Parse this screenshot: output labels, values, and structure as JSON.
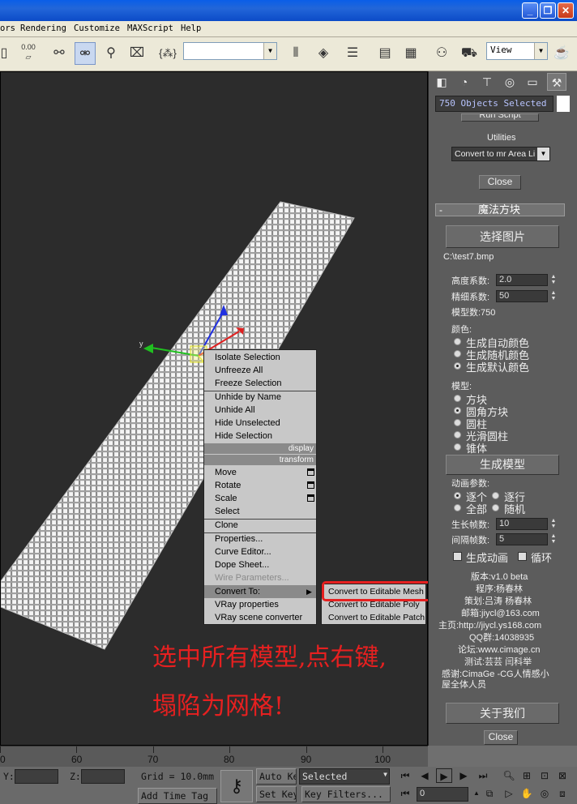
{
  "titlebar": {
    "minimize": "_",
    "restore": "❐",
    "close": "✕"
  },
  "menubar": {
    "items": [
      "ors",
      "Rendering",
      "Customize",
      "MAXScript",
      "Help"
    ]
  },
  "toolbar": {
    "spinner_value": "0.00",
    "named_selection": "",
    "view_dropdown": "View",
    "braces": "{⁂}"
  },
  "command_panel": {
    "objects_selected": "750 Objects Selected",
    "run_script": "Run Script",
    "utilities_label": "Utilities",
    "utility_dropdown": "Convert to mr Area Li",
    "close_top": "Close",
    "rollout_toggle": "-",
    "rollout_title": "魔法方块",
    "select_image": "选择图片",
    "image_path": "C:\\test7.bmp",
    "height_label": "高度系数:",
    "height_value": "2.0",
    "detail_label": "精细系数:",
    "detail_value": "50",
    "model_count": "模型数:750",
    "color_label": "颜色:",
    "color_options": [
      "生成自动颜色",
      "生成随机颜色",
      "生成默认颜色"
    ],
    "model_label": "模型:",
    "model_options": [
      "方块",
      "圆角方块",
      "圆柱",
      "光滑圆柱",
      "锥体"
    ],
    "generate_model": "生成模型",
    "anim_label": "动画参数:",
    "anim_options": [
      "逐个",
      "逐行",
      "全部",
      "随机"
    ],
    "grow_label": "生长帧数:",
    "grow_value": "10",
    "interval_label": "间隔帧数:",
    "interval_value": "5",
    "gen_anim": "生成动画",
    "loop": "循环",
    "info": [
      "版本:v1.0 beta",
      "程序:杨春林",
      "策划:吕涛 杨春林",
      "邮箱:jiycl@163.com",
      "主页:http://jiycl.ys168.com",
      "QQ群:14038935",
      "论坛:www.cimage.cn",
      "测试:芸芸 闫科举",
      "感谢:CimaGe -CG人情感小",
      "屋全体人员"
    ],
    "about": "关于我们",
    "close_bottom": "Close"
  },
  "quad_menu": {
    "display_items": [
      "Isolate Selection",
      "Unfreeze All",
      "Freeze Selection",
      "Unhide by Name",
      "Unhide All",
      "Hide Unselected",
      "Hide Selection"
    ],
    "display_header": "display",
    "transform_header": "transform",
    "transform_items": [
      "Move",
      "Rotate",
      "Scale",
      "Select",
      "Clone",
      "Properties...",
      "Curve Editor...",
      "Dope Sheet...",
      "Wire Parameters...",
      "Convert To:",
      "VRay properties",
      "VRay scene converter"
    ],
    "submenu": [
      "Convert to Editable Mesh",
      "Convert to Editable Poly",
      "Convert to Editable Patch"
    ]
  },
  "axes": {
    "x": "x",
    "y": "y",
    "z": "z"
  },
  "annotation": {
    "line1": "选中所有模型,点右键,",
    "line2": "塌陷为网格!"
  },
  "timeline": {
    "ticks": [
      "0",
      "60",
      "70",
      "80",
      "90",
      "100"
    ]
  },
  "statusbar": {
    "y_label": "Y:",
    "z_label": "Z:",
    "grid": "Grid = 10.0mm",
    "auto_key": "Auto Key",
    "selected": "Selected",
    "set_key": "Set Key",
    "key_filters": "Key Filters...",
    "add_time_tag": "Add Time Tag",
    "frame": "0"
  },
  "colors": {
    "annotation_red": "#e62020",
    "title_blue": "#0a5ee8",
    "panel_gray": "#5c5c5c"
  }
}
